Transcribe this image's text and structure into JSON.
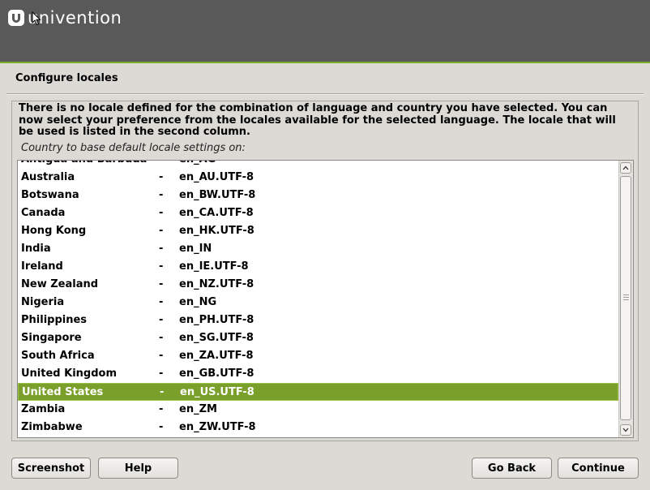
{
  "header": {
    "logo_text": "univention"
  },
  "page": {
    "title": "Configure locales",
    "message": "There is no locale defined for the combination of language and country you have selected. You can now select your preference from the locales available for the selected language. The locale that will be used is listed in the second column.",
    "prompt": "Country to base default locale settings on:"
  },
  "list": {
    "separator": "-",
    "items": [
      {
        "country": "Antigua and Barbuda",
        "locale": "en_AG",
        "selected": false
      },
      {
        "country": "Australia",
        "locale": "en_AU.UTF-8",
        "selected": false
      },
      {
        "country": "Botswana",
        "locale": "en_BW.UTF-8",
        "selected": false
      },
      {
        "country": "Canada",
        "locale": "en_CA.UTF-8",
        "selected": false
      },
      {
        "country": "Hong Kong",
        "locale": "en_HK.UTF-8",
        "selected": false
      },
      {
        "country": "India",
        "locale": "en_IN",
        "selected": false
      },
      {
        "country": "Ireland",
        "locale": "en_IE.UTF-8",
        "selected": false
      },
      {
        "country": "New Zealand",
        "locale": "en_NZ.UTF-8",
        "selected": false
      },
      {
        "country": "Nigeria",
        "locale": "en_NG",
        "selected": false
      },
      {
        "country": "Philippines",
        "locale": "en_PH.UTF-8",
        "selected": false
      },
      {
        "country": "Singapore",
        "locale": "en_SG.UTF-8",
        "selected": false
      },
      {
        "country": "South Africa",
        "locale": "en_ZA.UTF-8",
        "selected": false
      },
      {
        "country": "United Kingdom",
        "locale": "en_GB.UTF-8",
        "selected": false
      },
      {
        "country": "United States",
        "locale": "en_US.UTF-8",
        "selected": true
      },
      {
        "country": "Zambia",
        "locale": "en_ZM",
        "selected": false
      },
      {
        "country": "Zimbabwe",
        "locale": "en_ZW.UTF-8",
        "selected": false
      }
    ]
  },
  "buttons": {
    "screenshot": "Screenshot",
    "help": "Help",
    "go_back": "Go Back",
    "continue": "Continue"
  },
  "colors": {
    "header_bg": "#595959",
    "accent": "#7aa02b",
    "window_bg": "#dcdad5"
  },
  "icons": {
    "logo": "univention-logo-icon",
    "cursor": "mouse-pointer-icon",
    "scroll_up": "chevron-up-icon",
    "scroll_down": "chevron-down-icon"
  }
}
